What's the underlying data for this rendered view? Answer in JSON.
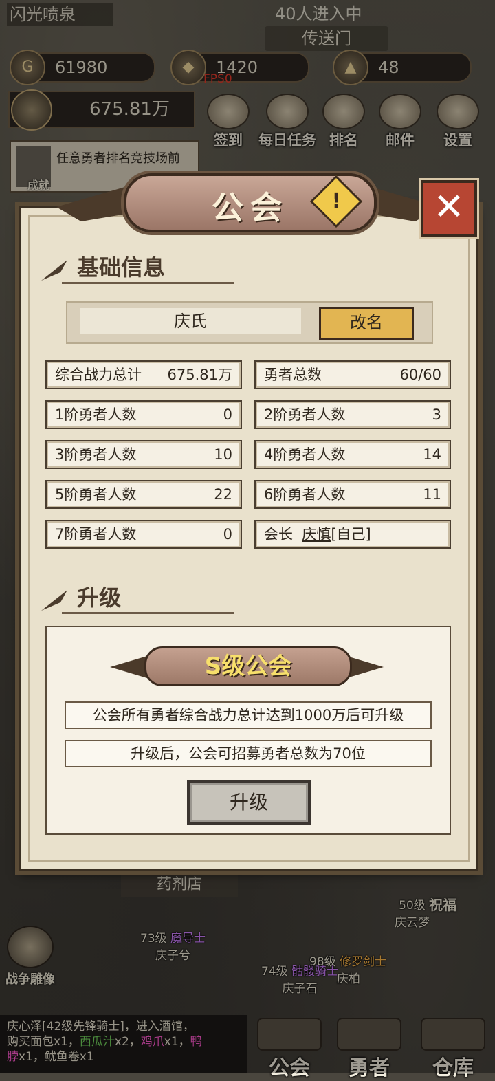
{
  "hud": {
    "area_name": "闪光喷泉",
    "online": "40人进入中",
    "portal": "传送门",
    "gold": "61980",
    "gems": "1420",
    "fps": "FPS0",
    "tokens": "48",
    "power": "675.81万",
    "menu": [
      {
        "label": "签到",
        "icon": "quill-icon"
      },
      {
        "label": "每日任务",
        "icon": "scroll-icon"
      },
      {
        "label": "排名",
        "icon": "trophy-icon"
      },
      {
        "label": "邮件",
        "icon": "mail-icon"
      },
      {
        "label": "设置",
        "icon": "gear-icon"
      }
    ],
    "task_text": "任意勇者排名竞技场前",
    "task_label": "成就"
  },
  "dialog": {
    "title": "公会",
    "close": "✕",
    "info_mark": "!",
    "basic_title": "基础信息",
    "guild_name": "庆氏",
    "rename": "改名",
    "stats": [
      {
        "k": "综合战力总计",
        "v": "675.81万"
      },
      {
        "k": "勇者总数",
        "v": "60/60"
      },
      {
        "k": "1阶勇者人数",
        "v": "0"
      },
      {
        "k": "2阶勇者人数",
        "v": "3"
      },
      {
        "k": "3阶勇者人数",
        "v": "10"
      },
      {
        "k": "4阶勇者人数",
        "v": "14"
      },
      {
        "k": "5阶勇者人数",
        "v": "22"
      },
      {
        "k": "6阶勇者人数",
        "v": "11"
      },
      {
        "k": "7阶勇者人数",
        "v": "0"
      }
    ],
    "leader_label": "会长",
    "leader_name": "庆慎",
    "leader_suffix": "[自己]",
    "upgrade_title": "升级",
    "grade": "S级公会",
    "cond1": "公会所有勇者综合战力总计达到1000万后可升级",
    "cond2": "升级后，公会可招募勇者总数为70位",
    "upgrade_btn": "升级"
  },
  "scene": {
    "shop": "药剂店",
    "npc1_lv": "73级",
    "npc1_cls": "魔导士",
    "npc1_name": "庆子兮",
    "npc2_lv": "74级",
    "npc2_cls": "骷髅骑士",
    "npc2_name": "庆子石",
    "npc3_lv": "98级",
    "npc3_cls": "修罗剑士",
    "npc3_name": "庆柏",
    "npc4_lv": "50级",
    "npc4_name": "庆云梦",
    "bless": "祝福",
    "war": "战争雕像"
  },
  "chat": {
    "line1": "庆心泽[42级先锋骑士]，进入酒馆，",
    "line2a": "购买面包x1，",
    "line2b": "西瓜汁",
    "line2c": "x2，",
    "line2d": "鸡爪",
    "line2e": "x1，",
    "line2f": "鸭",
    "line3a": "脖",
    "line3b": "x1，鱿鱼卷x1"
  },
  "nav": {
    "guild": "公会",
    "heroes": "勇者",
    "storage": "仓库"
  }
}
